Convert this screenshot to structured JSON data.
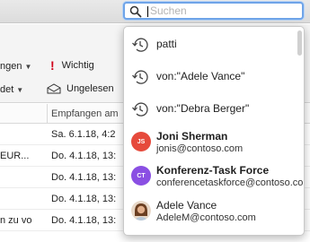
{
  "search": {
    "placeholder": "Suchen",
    "value": ""
  },
  "ribbon": {
    "item1_label": "ngen",
    "item2_label": "Wichtig",
    "item3_label": "det",
    "item4_label": "Ungelesen"
  },
  "message_list": {
    "column_header": "Empfangen am",
    "rows": [
      {
        "left": "",
        "date": "Sa. 6.1.18, 4:2"
      },
      {
        "left": "EUR...",
        "date": "Do. 4.1.18, 13:"
      },
      {
        "left": "",
        "date": "Do. 4.1.18, 13:"
      },
      {
        "left": "",
        "date": "Do. 4.1.18, 13:"
      },
      {
        "left": "n zu vo",
        "date": "Do. 4.1.18, 13:"
      }
    ]
  },
  "suggestions": {
    "history": [
      {
        "text": "patti"
      },
      {
        "text": "von:\"Adele Vance\""
      },
      {
        "text": "von:\"Debra Berger\""
      }
    ],
    "people": [
      {
        "initials": "JS",
        "name": "Joni Sherman",
        "email": "jonis@contoso.com",
        "color": "#e64a3c"
      },
      {
        "initials": "CT",
        "name": "Konferenz-Task Force",
        "email": "conferencetaskforce@contoso.com",
        "color": "#8a4fe3"
      },
      {
        "initials": "",
        "name": "Adele Vance",
        "email": "AdeleM@contoso.com",
        "color": "#c98a5a"
      }
    ]
  },
  "colors": {
    "search_focus": "#6fa4e8",
    "important_flag": "#d0021b"
  }
}
